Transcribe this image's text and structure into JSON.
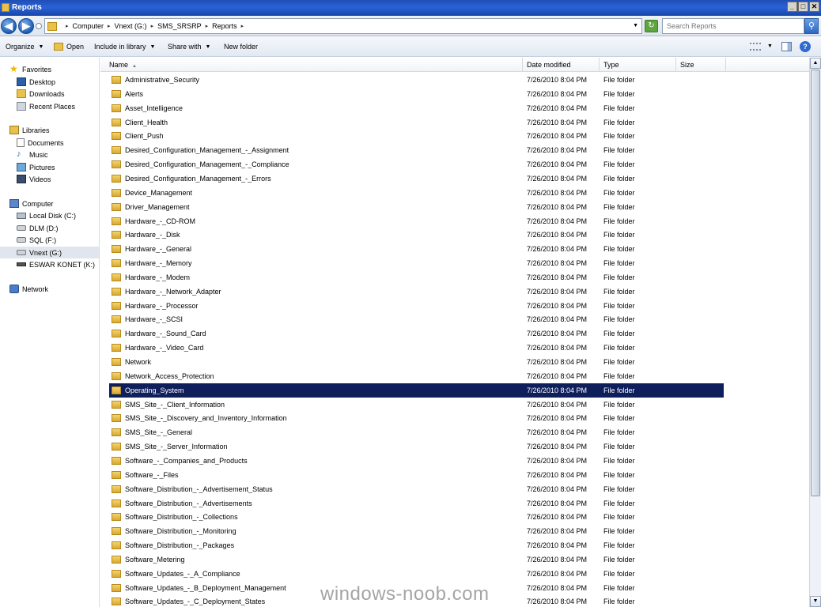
{
  "window": {
    "title": "Reports",
    "min_label": "_",
    "max_label": "□",
    "close_label": "✕"
  },
  "address": {
    "back_glyph": "◀",
    "forward_glyph": "▶",
    "breadcrumb": [
      "Computer",
      "Vnext (G:)",
      "SMS_SRSRP",
      "Reports"
    ],
    "refresh_glyph": "↻",
    "search_placeholder": "Search Reports",
    "search_glyph": "⚲"
  },
  "toolbar": {
    "organize": "Organize",
    "open": "Open",
    "include": "Include in library",
    "share": "Share with",
    "new_folder": "New folder"
  },
  "nav": {
    "favorites": {
      "label": "Favorites",
      "items": [
        "Desktop",
        "Downloads",
        "Recent Places"
      ]
    },
    "libraries": {
      "label": "Libraries",
      "items": [
        "Documents",
        "Music",
        "Pictures",
        "Videos"
      ]
    },
    "computer": {
      "label": "Computer",
      "items": [
        "Local Disk (C:)",
        "DLM (D:)",
        "SQL (F:)",
        "Vnext (G:)",
        "ESWAR KONET (K:)"
      ]
    },
    "network": {
      "label": "Network"
    }
  },
  "columns": {
    "name": "Name",
    "date": "Date modified",
    "type": "Type",
    "size": "Size"
  },
  "files": [
    [
      "Administrative_Security",
      "7/26/2010 8:04 PM",
      "File folder"
    ],
    [
      "Alerts",
      "7/26/2010 8:04 PM",
      "File folder"
    ],
    [
      "Asset_Intelligence",
      "7/26/2010 8:04 PM",
      "File folder"
    ],
    [
      "Client_Health",
      "7/26/2010 8:04 PM",
      "File folder"
    ],
    [
      "Client_Push",
      "7/26/2010 8:04 PM",
      "File folder"
    ],
    [
      "Desired_Configuration_Management_-_Assignment",
      "7/26/2010 8:04 PM",
      "File folder"
    ],
    [
      "Desired_Configuration_Management_-_Compliance",
      "7/26/2010 8:04 PM",
      "File folder"
    ],
    [
      "Desired_Configuration_Management_-_Errors",
      "7/26/2010 8:04 PM",
      "File folder"
    ],
    [
      "Device_Management",
      "7/26/2010 8:04 PM",
      "File folder"
    ],
    [
      "Driver_Management",
      "7/26/2010 8:04 PM",
      "File folder"
    ],
    [
      "Hardware_-_CD-ROM",
      "7/26/2010 8:04 PM",
      "File folder"
    ],
    [
      "Hardware_-_Disk",
      "7/26/2010 8:04 PM",
      "File folder"
    ],
    [
      "Hardware_-_General",
      "7/26/2010 8:04 PM",
      "File folder"
    ],
    [
      "Hardware_-_Memory",
      "7/26/2010 8:04 PM",
      "File folder"
    ],
    [
      "Hardware_-_Modem",
      "7/26/2010 8:04 PM",
      "File folder"
    ],
    [
      "Hardware_-_Network_Adapter",
      "7/26/2010 8:04 PM",
      "File folder"
    ],
    [
      "Hardware_-_Processor",
      "7/26/2010 8:04 PM",
      "File folder"
    ],
    [
      "Hardware_-_SCSI",
      "7/26/2010 8:04 PM",
      "File folder"
    ],
    [
      "Hardware_-_Sound_Card",
      "7/26/2010 8:04 PM",
      "File folder"
    ],
    [
      "Hardware_-_Video_Card",
      "7/26/2010 8:04 PM",
      "File folder"
    ],
    [
      "Network",
      "7/26/2010 8:04 PM",
      "File folder"
    ],
    [
      "Network_Access_Protection",
      "7/26/2010 8:04 PM",
      "File folder"
    ],
    [
      "Operating_System",
      "7/26/2010 8:04 PM",
      "File folder"
    ],
    [
      "SMS_Site_-_Client_Information",
      "7/26/2010 8:04 PM",
      "File folder"
    ],
    [
      "SMS_Site_-_Discovery_and_Inventory_Information",
      "7/26/2010 8:04 PM",
      "File folder"
    ],
    [
      "SMS_Site_-_General",
      "7/26/2010 8:04 PM",
      "File folder"
    ],
    [
      "SMS_Site_-_Server_Information",
      "7/26/2010 8:04 PM",
      "File folder"
    ],
    [
      "Software_-_Companies_and_Products",
      "7/26/2010 8:04 PM",
      "File folder"
    ],
    [
      "Software_-_Files",
      "7/26/2010 8:04 PM",
      "File folder"
    ],
    [
      "Software_Distribution_-_Advertisement_Status",
      "7/26/2010 8:04 PM",
      "File folder"
    ],
    [
      "Software_Distribution_-_Advertisements",
      "7/26/2010 8:04 PM",
      "File folder"
    ],
    [
      "Software_Distribution_-_Collections",
      "7/26/2010 8:04 PM",
      "File folder"
    ],
    [
      "Software_Distribution_-_Monitoring",
      "7/26/2010 8:04 PM",
      "File folder"
    ],
    [
      "Software_Distribution_-_Packages",
      "7/26/2010 8:04 PM",
      "File folder"
    ],
    [
      "Software_Metering",
      "7/26/2010 8:04 PM",
      "File folder"
    ],
    [
      "Software_Updates_-_A_Compliance",
      "7/26/2010 8:04 PM",
      "File folder"
    ],
    [
      "Software_Updates_-_B_Deployment_Management",
      "7/26/2010 8:04 PM",
      "File folder"
    ],
    [
      "Software_Updates_-_C_Deployment_States",
      "7/26/2010 8:04 PM",
      "File folder"
    ]
  ],
  "selected_file": "Operating_System",
  "watermark": "windows-noob.com",
  "colors": {
    "selection": "#0f1f5b",
    "titlebar": "#2a62d6"
  }
}
